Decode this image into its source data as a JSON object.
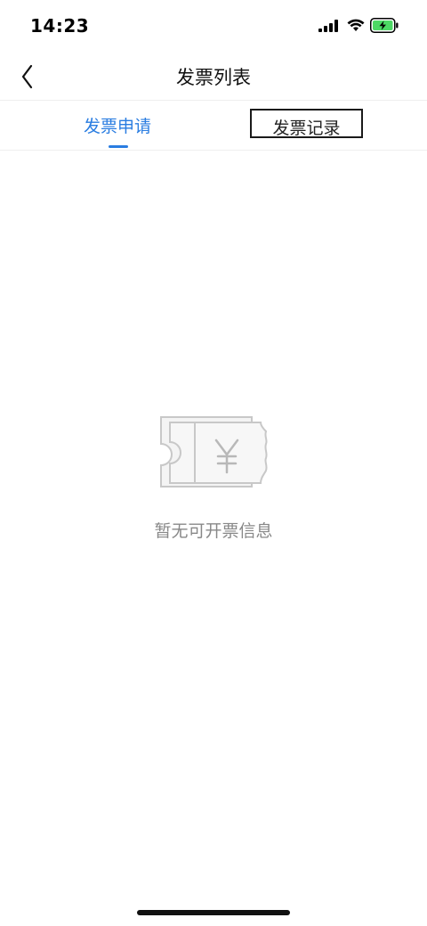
{
  "status_bar": {
    "time": "14:23"
  },
  "nav": {
    "title": "发票列表",
    "back_icon": "chevron-left-icon"
  },
  "tabs": [
    {
      "label": "发票申请",
      "active": true
    },
    {
      "label": "发票记录",
      "active": false
    }
  ],
  "empty_state": {
    "icon": "ticket-yen-icon",
    "message": "暂无可开票信息"
  },
  "colors": {
    "accent": "#2a7de1",
    "empty_text": "#888888",
    "battery_fill": "#4cd964"
  }
}
